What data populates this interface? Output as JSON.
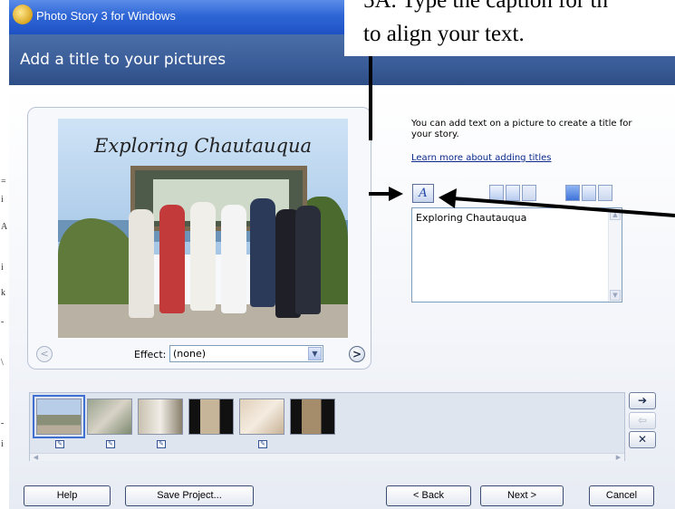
{
  "window": {
    "title": "Photo Story 3 for Windows"
  },
  "header": {
    "title": "Add a title to your pictures"
  },
  "annotation": {
    "line1": "5A.  Type the caption for th",
    "line2": "to align your text."
  },
  "preview": {
    "caption": "Exploring Chautauqua",
    "effect_label": "Effect:",
    "effect_value": "(none)",
    "prev_glyph": "<",
    "next_glyph": ">"
  },
  "info": {
    "text": "You can add text on a picture to create a title for your story.",
    "link": "Learn more about adding titles"
  },
  "caption_box": {
    "value": "Exploring Chautauqua"
  },
  "toolbar": {
    "font_glyph": "A",
    "buttons": [
      "align-left",
      "align-center",
      "align-right",
      "valign-top",
      "valign-middle",
      "valign-bottom"
    ]
  },
  "filmstrip": {
    "thumbnails": 6,
    "selected_index": 0
  },
  "side_buttons": {
    "right_glyph": "➔",
    "left_glyph": "⇦",
    "remove_glyph": "✕"
  },
  "buttons": {
    "help": "Help",
    "save": "Save Project...",
    "back": "< Back",
    "next": "Next >",
    "cancel": "Cancel"
  },
  "colors": {
    "titlebar": "#2f66d6",
    "header": "#3a5c98",
    "link": "#0b2a8c"
  }
}
